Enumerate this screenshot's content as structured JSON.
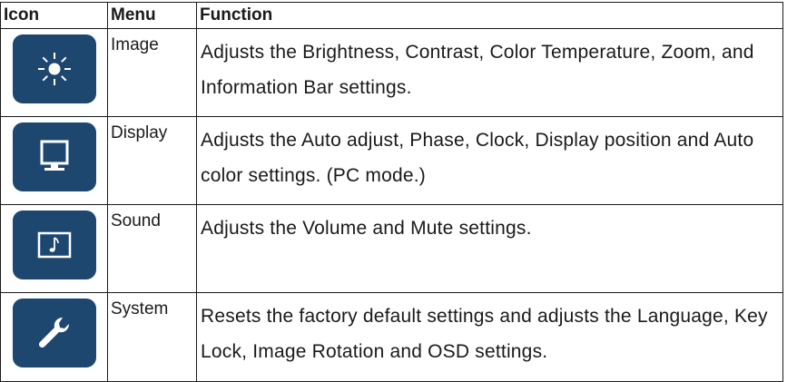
{
  "table": {
    "headers": {
      "icon": "Icon",
      "menu": "Menu",
      "function": "Function"
    },
    "rows": [
      {
        "icon": "brightness-sun-icon",
        "menu": "Image",
        "function": "Adjusts the Brightness, Contrast, Color Temperature, Zoom, and Information Bar settings."
      },
      {
        "icon": "monitor-display-icon",
        "menu": "Display",
        "function": "Adjusts the Auto adjust, Phase, Clock, Display position and Auto color settings. (PC mode.)"
      },
      {
        "icon": "music-note-icon",
        "menu": "Sound",
        "function": "Adjusts the Volume and Mute settings."
      },
      {
        "icon": "wrench-icon",
        "menu": "System",
        "function": "Resets the factory default settings and adjusts the Language, Key Lock, Image Rotation and OSD settings."
      }
    ]
  },
  "colors": {
    "icon_tile": "#1e4770",
    "icon_glyph": "#ffffff",
    "border": "#1a1a1a"
  }
}
